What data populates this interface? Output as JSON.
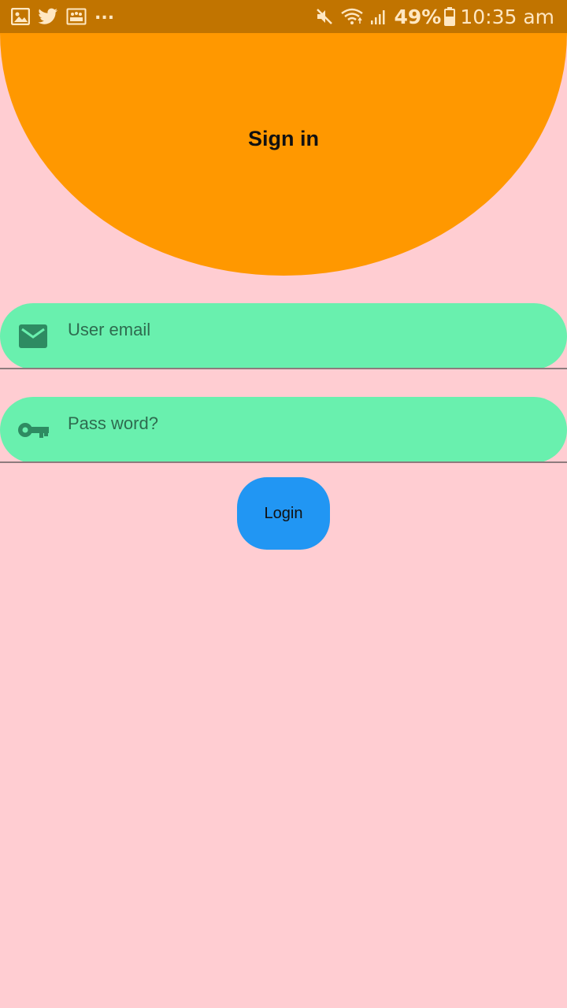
{
  "status_bar": {
    "icons_left": [
      "gallery-icon",
      "twitter-icon",
      "photo-icon"
    ],
    "more": "...",
    "icons_right": [
      "mute-icon",
      "wifi-icon",
      "signal-icon"
    ],
    "battery": "49%",
    "time": "10:35 am"
  },
  "header": {
    "title": "Sign in"
  },
  "form": {
    "email": {
      "icon": "email-icon",
      "placeholder": "User email",
      "value": ""
    },
    "password": {
      "icon": "key-icon",
      "placeholder": "Pass word?",
      "value": ""
    },
    "login_label": "Login"
  },
  "colors": {
    "background": "#ffcdd2",
    "status_bar": "#c17400",
    "header": "#ff9800",
    "field": "#69f0ae",
    "button": "#2196f3"
  }
}
